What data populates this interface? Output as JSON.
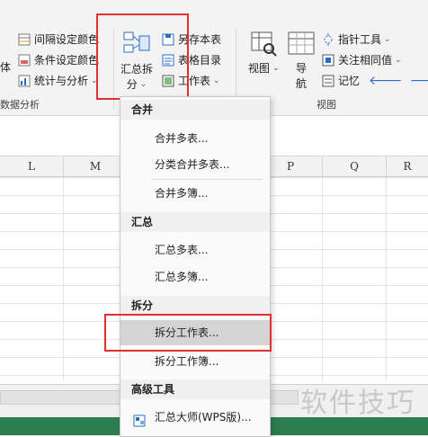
{
  "ribbon": {
    "left_partial_char": "体",
    "interval_color": "间隔设定颜色",
    "condition_color": "条件设定颜色",
    "stats": "统计与分析",
    "data_analysis_group": "数据分析",
    "merge_split": {
      "line1": "汇总拆",
      "line2": "分"
    },
    "save_table": "另存本表",
    "table_directory": "表格目录",
    "worksheet": "工作表",
    "view_label": "视图",
    "nav_line1": "导",
    "nav_line2": "航",
    "pointer_tool": "指针工具",
    "focus_same": "关注相同值",
    "memo": "记忆",
    "view_group": "视图"
  },
  "columns": [
    "L",
    "M",
    "P",
    "Q",
    "R"
  ],
  "menu": {
    "sections": [
      {
        "title": "合并",
        "items": [
          "合并多表...",
          "分类合并多表...",
          "合并多簿..."
        ]
      },
      {
        "title": "汇总",
        "items": [
          "汇总多表...",
          "汇总多簿..."
        ]
      },
      {
        "title": "拆分",
        "items": [
          "拆分工作表...",
          "拆分工作簿..."
        ]
      },
      {
        "title": "高级工具",
        "items": [
          "汇总大师(WPS版)..."
        ]
      }
    ],
    "selected_item": "拆分工作表..."
  },
  "watermark": "软件技巧",
  "colors": {
    "highlight_red": "#e03030",
    "accent_blue": "#2b6cc4",
    "status_green": "#2e7d4f"
  }
}
